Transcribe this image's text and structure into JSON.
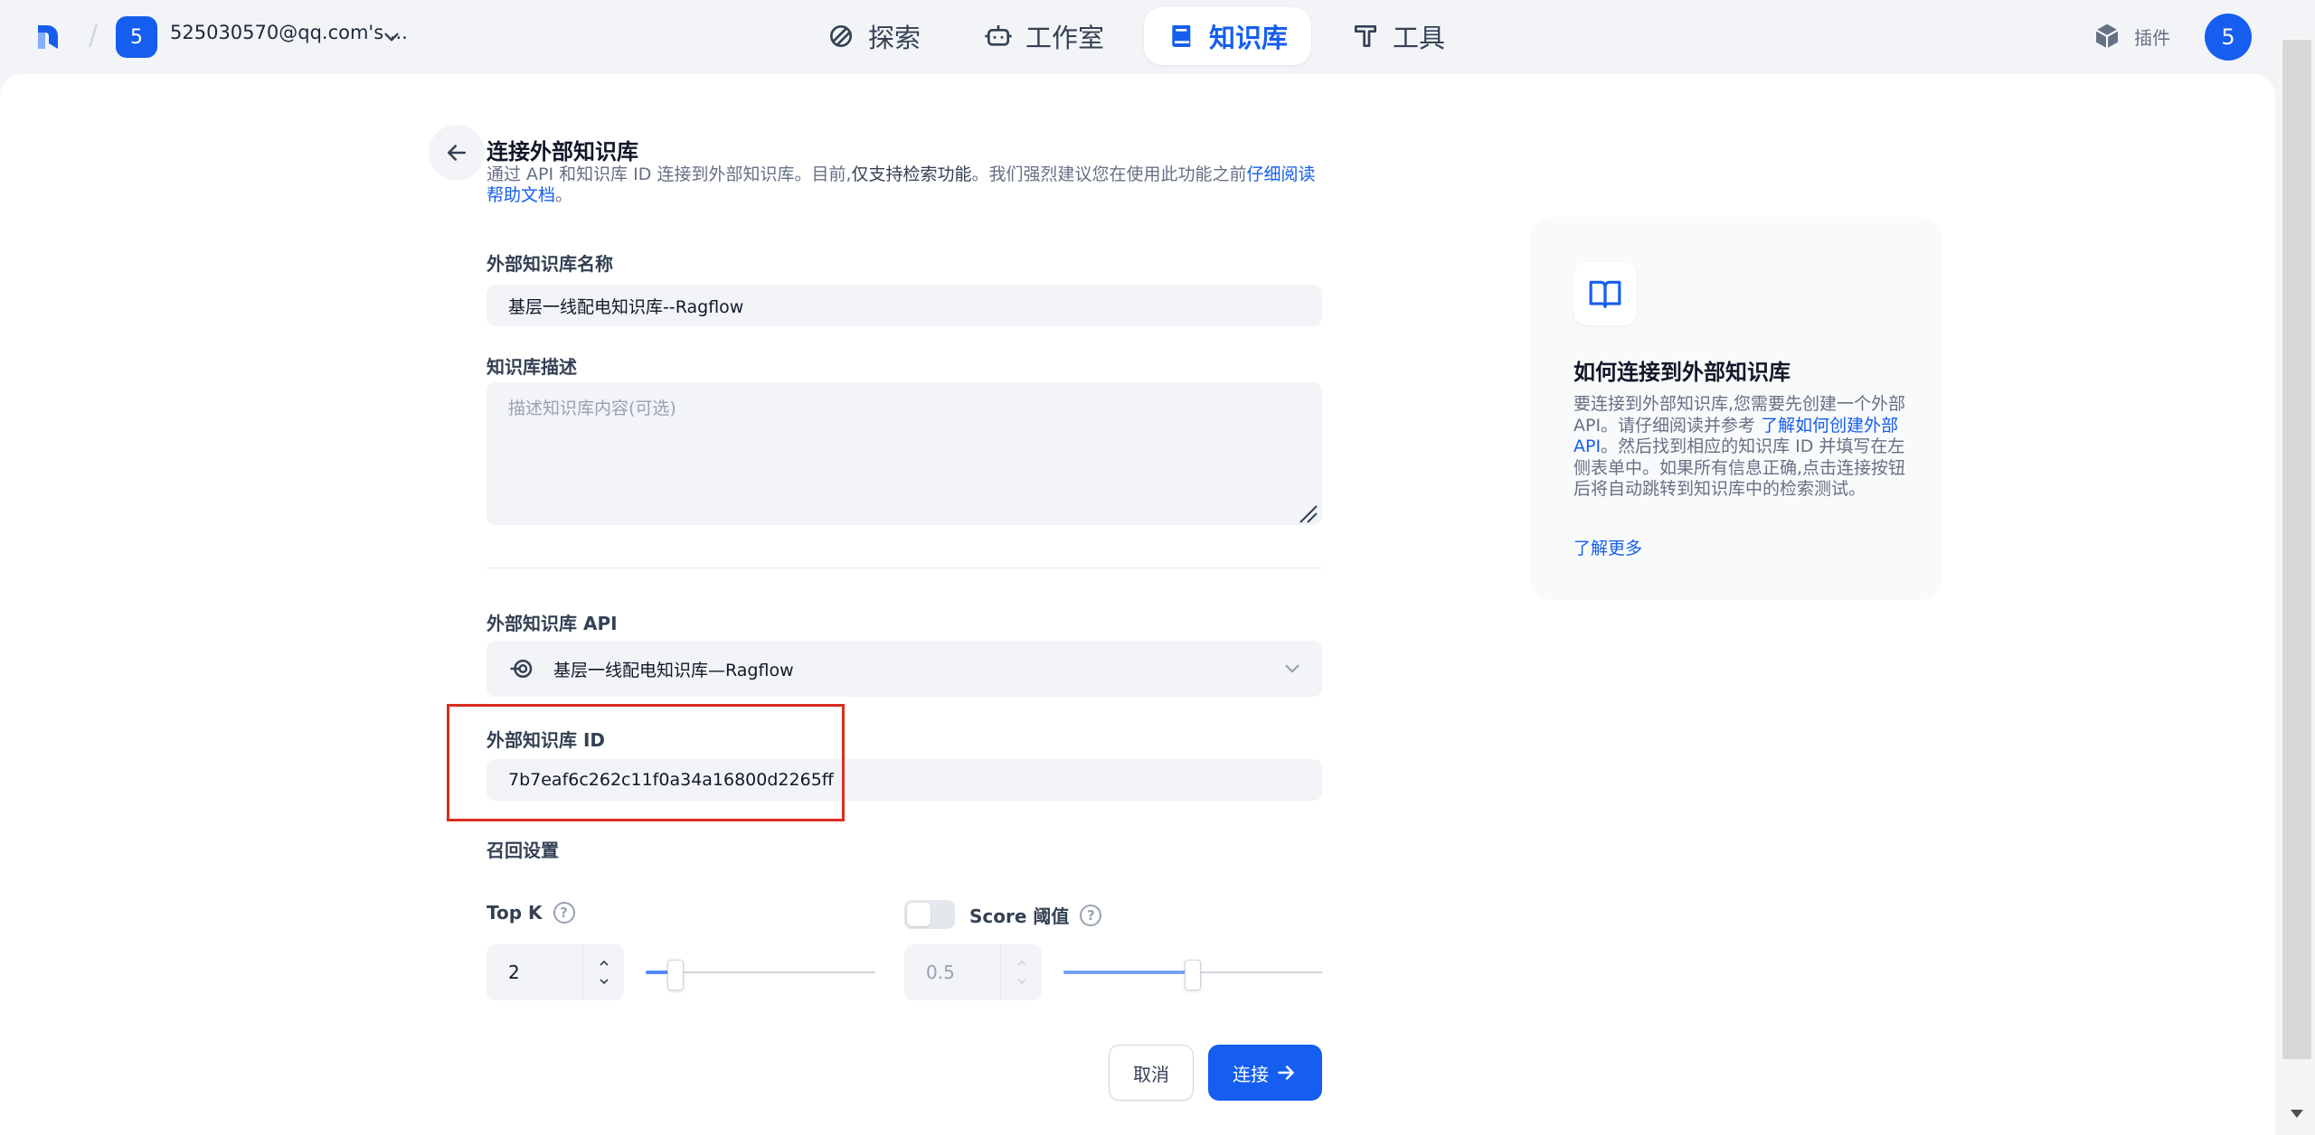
{
  "header": {
    "workspace_avatar": "5",
    "workspace_name": "525030570@qq.com's ...",
    "nav": [
      {
        "label": "探索",
        "icon": "explore-icon"
      },
      {
        "label": "工作室",
        "icon": "robot-icon"
      },
      {
        "label": "知识库",
        "icon": "book-icon",
        "active": true
      },
      {
        "label": "工具",
        "icon": "tool-icon"
      }
    ],
    "plugin_label": "插件",
    "user_avatar": "5"
  },
  "page": {
    "title": "连接外部知识库",
    "desc_prefix": "通过 API 和知识库 ID 连接到外部知识库。目前,",
    "desc_strong": "仅支持检索功能",
    "desc_middle": "。我们强烈建议您在使用此功能之前",
    "desc_link": "仔细阅读帮助文档",
    "desc_end": "。"
  },
  "form": {
    "name_label": "外部知识库名称",
    "name_value": "基层一线配电知识库--Ragflow",
    "desc_label": "知识库描述",
    "desc_placeholder": "描述知识库内容(可选)",
    "api_label": "外部知识库 API",
    "api_value": "基层一线配电知识库—Ragflow",
    "id_label": "外部知识库 ID",
    "id_value": "7b7eaf6c262c11f0a34a16800d2265ff",
    "retrieval_label": "召回设置",
    "topk_label": "Top K",
    "topk_value": "2",
    "topk_slider_fraction": 0.13,
    "score_label": "Score 阈值",
    "score_value": "0.5",
    "score_enabled": false,
    "score_slider_fraction": 0.5,
    "cancel_label": "取消",
    "connect_label": "连接"
  },
  "info": {
    "title": "如何连接到外部知识库",
    "body_1": "要连接到外部知识库,您需要先创建一个外部 API。请仔细阅读并参考 ",
    "body_link": "了解如何创建外部 API",
    "body_2": "。然后找到相应的知识库 ID 并填写在左侧表单中。如果所有信息正确,点击连接按钮后将自动跳转到知识库中的检索测试。",
    "more_label": "了解更多"
  },
  "colors": {
    "accent": "#155eef",
    "highlight_border": "#d92d20"
  }
}
